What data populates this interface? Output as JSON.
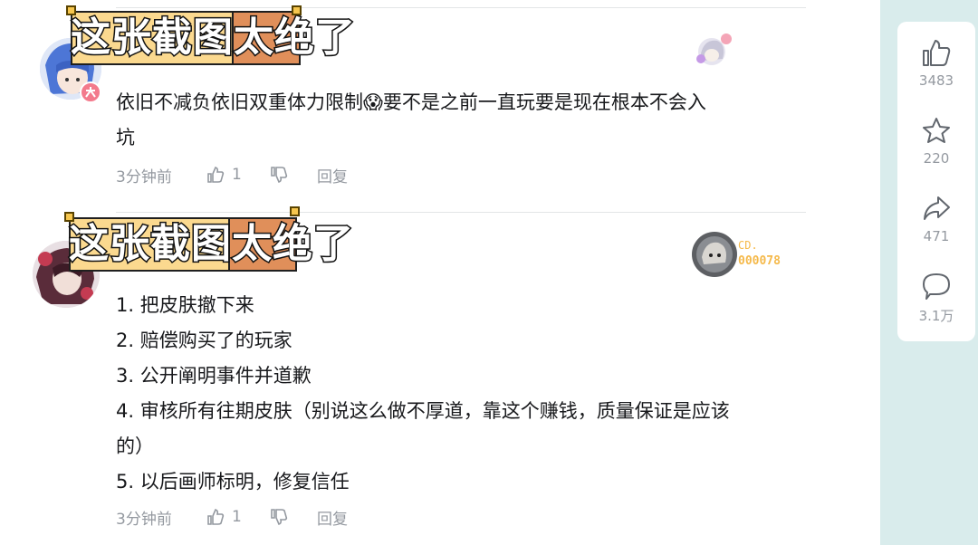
{
  "overlay_caption": {
    "part1": "这张截图",
    "part2": "太绝了"
  },
  "comments": [
    {
      "text_lines": [
        "依旧不减负依旧双重体力限制😱要不是之前一直玩要是现在根本不会入",
        "坑"
      ],
      "time": "3分钟前",
      "likes": "1",
      "reply_label": "回复"
    },
    {
      "text_lines": [
        "1. 把皮肤撤下来",
        "2. 赔偿购买了的玩家",
        "3. 公开阐明事件并道歉",
        "4. 审核所有往期皮肤（别说这么做不厚道，靠这个赚钱，质量保证是应该",
        "的）",
        "5. 以后画师标明，修复信任"
      ],
      "time": "3分钟前",
      "likes": "1",
      "reply_label": "回复",
      "badge_text_top": "CD.",
      "badge_text_bottom": "000078"
    }
  ],
  "sidebar": {
    "like_count": "3483",
    "favorite_count": "220",
    "share_count": "471",
    "comment_count": "3.1万"
  },
  "colors": {
    "accent_badge": "#f7a13b",
    "text_muted": "#9499a0",
    "panel_bg": "#d9ecec"
  }
}
